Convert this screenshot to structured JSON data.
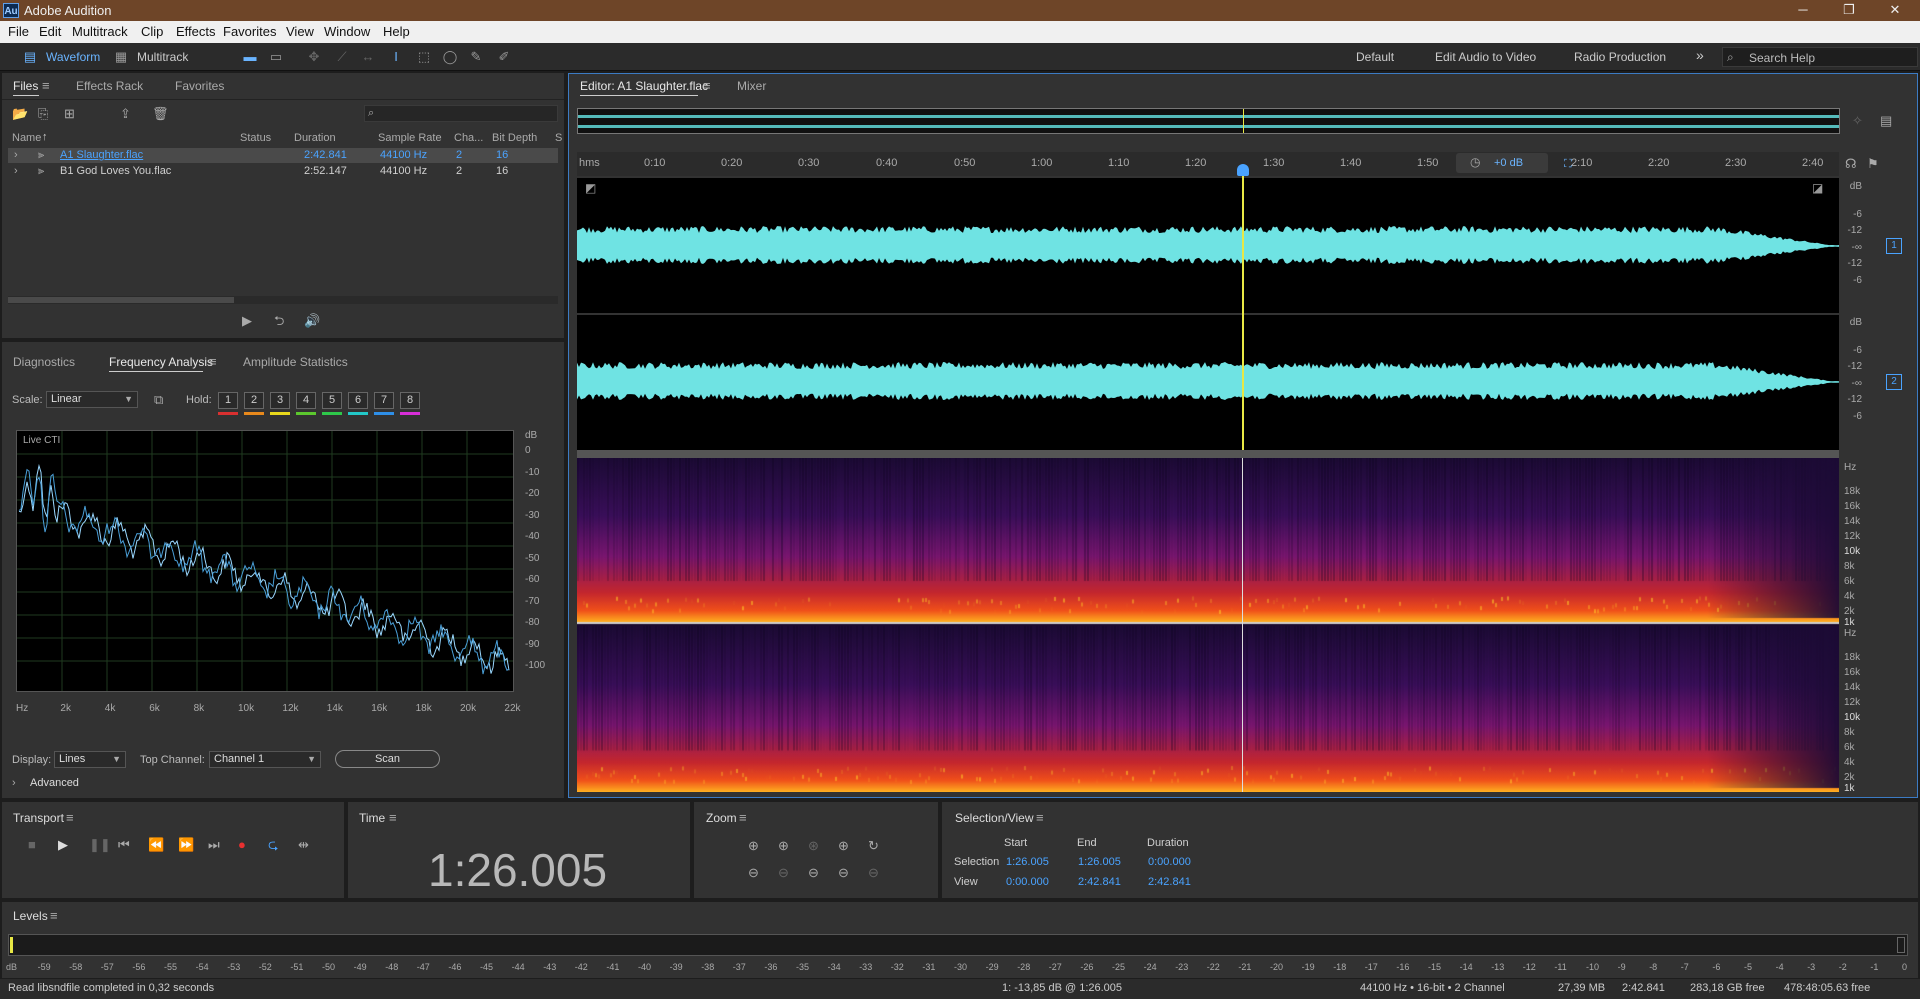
{
  "title_bar": {
    "app_title": "Adobe Audition",
    "logo": "Au"
  },
  "window_controls": {
    "minimize": "─",
    "maximize": "❐",
    "close": "✕"
  },
  "menu": [
    "File",
    "Edit",
    "Multitrack",
    "Clip",
    "Effects",
    "Favorites",
    "View",
    "Window",
    "Help"
  ],
  "toolbar": {
    "waveform_label": "Waveform",
    "multitrack_label": "Multitrack",
    "workspaces": [
      "Default",
      "Edit Audio to Video",
      "Radio Production"
    ],
    "more": "»",
    "search_placeholder": "Search Help"
  },
  "files_panel": {
    "tabs": [
      "Files",
      "Effects Rack",
      "Favorites"
    ],
    "columns": [
      "Name",
      "Status",
      "Duration",
      "Sample Rate",
      "Cha...",
      "Bit Depth",
      "S"
    ],
    "rows": [
      {
        "name": "A1 Slaughter.flac",
        "status": "",
        "duration": "2:42.841",
        "sample_rate": "44100 Hz",
        "channels": "2",
        "bit_depth": "16",
        "selected": true
      },
      {
        "name": "B1 God Loves You.flac",
        "status": "",
        "duration": "2:52.147",
        "sample_rate": "44100 Hz",
        "channels": "2",
        "bit_depth": "16",
        "selected": false
      }
    ]
  },
  "analysis_panel": {
    "tabs": [
      "Diagnostics",
      "Frequency Analysis",
      "Amplitude Statistics"
    ],
    "scale_label": "Scale:",
    "scale_value": "Linear",
    "hold_label": "Hold:",
    "hold_buttons": [
      "1",
      "2",
      "3",
      "4",
      "5",
      "6",
      "7",
      "8"
    ],
    "hold_colors": [
      "#d93030",
      "#e8891c",
      "#e8d81c",
      "#5cc82e",
      "#2ec84a",
      "#22c8c8",
      "#2e8fe8",
      "#d82ed8"
    ],
    "graph_label": "Live CTI",
    "y_unit": "dB",
    "y_ticks": [
      "0",
      "-10",
      "-20",
      "-30",
      "-40",
      "-50",
      "-60",
      "-70",
      "-80",
      "-90",
      "-100"
    ],
    "x_ticks": [
      "Hz",
      "2k",
      "4k",
      "6k",
      "8k",
      "10k",
      "12k",
      "14k",
      "16k",
      "18k",
      "20k",
      "22k"
    ],
    "display_label": "Display:",
    "display_value": "Lines",
    "top_channel_label": "Top Channel:",
    "top_channel_value": "Channel 1",
    "scan_label": "Scan",
    "advanced_label": "Advanced"
  },
  "editor": {
    "tab": "Editor: A1 Slaughter.flac",
    "mixer_tab": "Mixer",
    "ruler_unit": "hms",
    "ruler_ticks": [
      "0:10",
      "0:20",
      "0:30",
      "0:40",
      "0:50",
      "1:00",
      "1:10",
      "1:20",
      "1:30",
      "1:40",
      "1:50",
      "2:10",
      "2:20",
      "2:30",
      "2:40"
    ],
    "hud_gain": "+0 dB",
    "db_labels": [
      "dB",
      "-6",
      "-12",
      "-∞",
      "-12",
      "-6"
    ],
    "channels": [
      "1",
      "2"
    ],
    "hz_labels": [
      "Hz",
      "18k",
      "16k",
      "14k",
      "12k",
      "10k",
      "8k",
      "6k",
      "4k",
      "2k",
      "1k"
    ]
  },
  "transport": {
    "title": "Transport"
  },
  "time": {
    "title": "Time",
    "value": "1:26.005"
  },
  "zoom": {
    "title": "Zoom"
  },
  "selection_view": {
    "title": "Selection/View",
    "headers": [
      "Start",
      "End",
      "Duration"
    ],
    "rows": [
      {
        "label": "Selection",
        "start": "1:26.005",
        "end": "1:26.005",
        "duration": "0:00.000"
      },
      {
        "label": "View",
        "start": "0:00.000",
        "end": "2:42.841",
        "duration": "2:42.841"
      }
    ]
  },
  "levels": {
    "title": "Levels",
    "ticks": [
      "dB",
      "-59",
      "-58",
      "-57",
      "-56",
      "-55",
      "-54",
      "-53",
      "-52",
      "-51",
      "-50",
      "-49",
      "-48",
      "-47",
      "-46",
      "-45",
      "-44",
      "-43",
      "-42",
      "-41",
      "-40",
      "-39",
      "-38",
      "-37",
      "-36",
      "-35",
      "-34",
      "-33",
      "-32",
      "-31",
      "-30",
      "-29",
      "-28",
      "-27",
      "-26",
      "-25",
      "-24",
      "-23",
      "-22",
      "-21",
      "-20",
      "-19",
      "-18",
      "-17",
      "-16",
      "-15",
      "-14",
      "-13",
      "-12",
      "-11",
      "-10",
      "-9",
      "-8",
      "-7",
      "-6",
      "-5",
      "-4",
      "-3",
      "-2",
      "-1",
      "0"
    ]
  },
  "status_bar": {
    "message": "Read libsndfile completed in 0,32 seconds",
    "cursor_info": "1: -13,85 dB @ 1:26.005",
    "format": "44100 Hz • 16-bit • 2 Channel",
    "file_size": "27,39 MB",
    "duration": "2:42.841",
    "free_space": "283,18 GB free",
    "free_time": "478:48:05.63 free"
  },
  "colors": {
    "accent": "#4aa3ff",
    "waveform": "#6fe3e3",
    "playhead": "#e8e845",
    "titlebar": "#6e4528"
  }
}
